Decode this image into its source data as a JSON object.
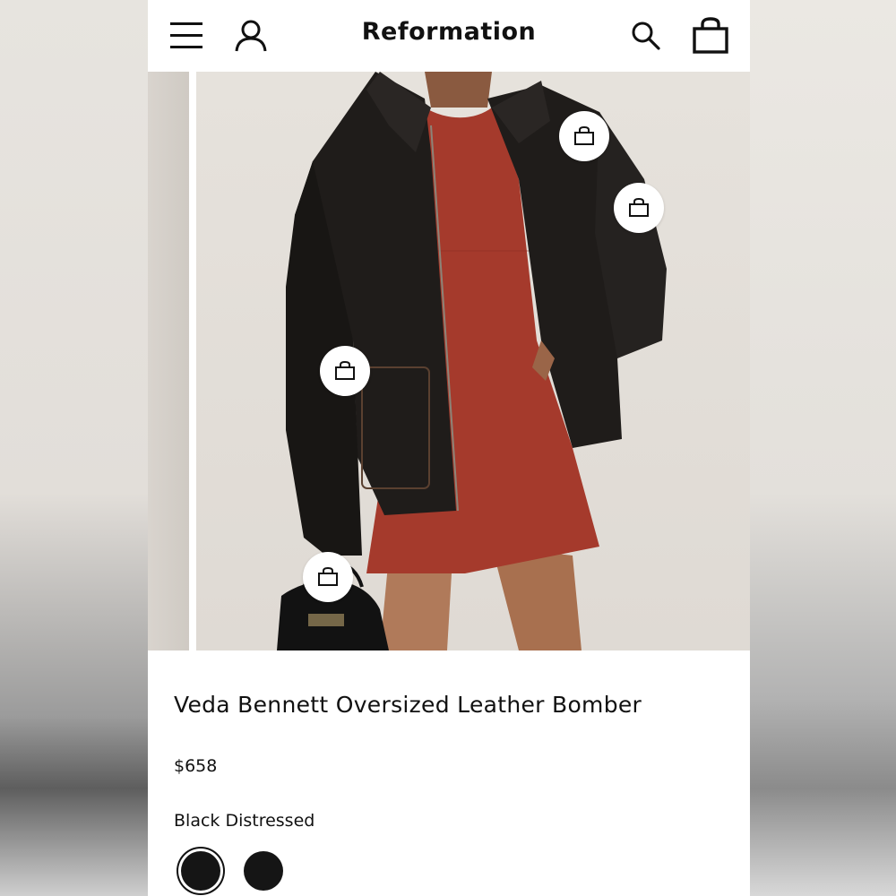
{
  "header": {
    "menu_icon": "hamburger-menu-icon",
    "account_icon": "user-account-icon",
    "brand": "Reformation",
    "search_icon": "search-icon",
    "cart_icon": "shopping-bag-icon"
  },
  "gallery": {
    "image_description": "model wearing black distressed leather bomber jacket over red dress",
    "shop_the_look_icon": "shopping-bag-icon",
    "shop_points_count": 4
  },
  "product": {
    "title": "Veda Bennett Oversized Leather Bomber",
    "price": "$658",
    "color_name": "Black Distressed",
    "swatches": [
      {
        "color": "#151515",
        "selected": true
      },
      {
        "color": "#151515",
        "selected": false
      }
    ]
  },
  "colors": {
    "background_white": "#ffffff",
    "text": "#111111",
    "jacket": "#1c1a18",
    "dress": "#a53a2c"
  }
}
